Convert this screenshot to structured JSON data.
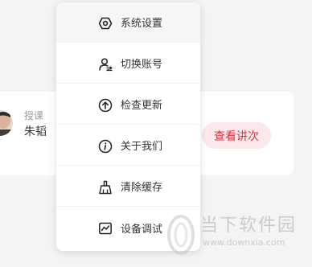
{
  "course_card": {
    "role_label": "授课",
    "teacher_name": "朱韬",
    "action_label": "查看讲次",
    "action_color": "#d0353f",
    "action_bg": "#fbe8ea"
  },
  "menu": {
    "items": [
      {
        "label": "系统设置",
        "icon": "settings-hex-icon"
      },
      {
        "label": "切换账号",
        "icon": "switch-account-icon"
      },
      {
        "label": "检查更新",
        "icon": "upload-arrow-icon"
      },
      {
        "label": "关于我们",
        "icon": "info-icon"
      },
      {
        "label": "清除缓存",
        "icon": "broom-icon"
      },
      {
        "label": "设备调试",
        "icon": "pulse-chart-icon"
      }
    ]
  },
  "watermark": {
    "title": "当下软件园",
    "url": "www.downxia.com"
  }
}
